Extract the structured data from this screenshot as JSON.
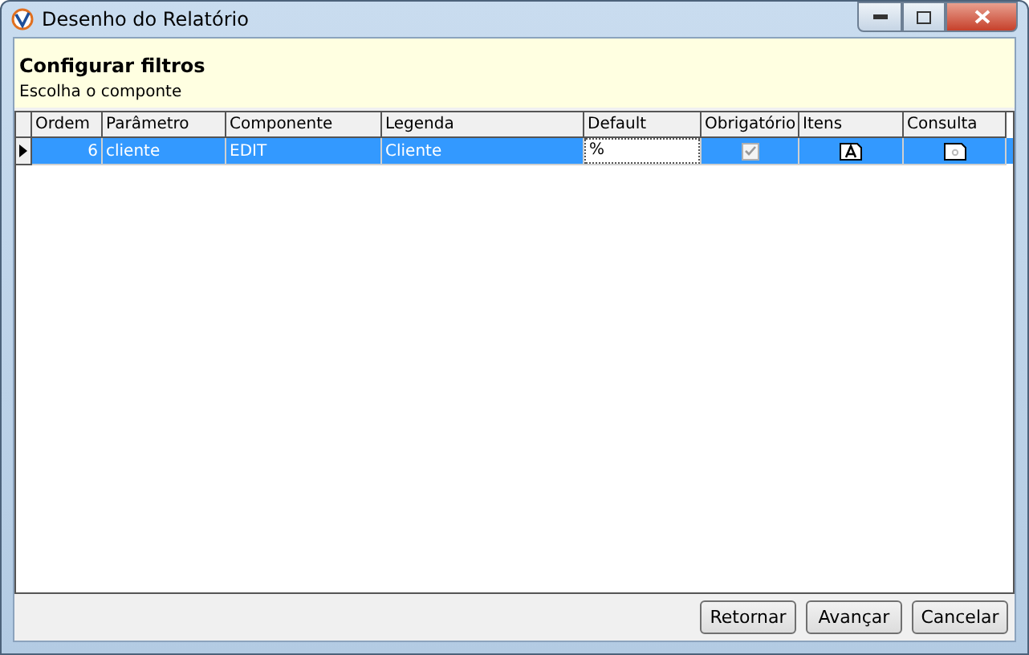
{
  "window": {
    "title": "Desenho do Relatório"
  },
  "header": {
    "title": "Configurar filtros",
    "subtitle": "Escolha o componte"
  },
  "table": {
    "columns": [
      "Ordem",
      "Parâmetro",
      "Componente",
      "Legenda",
      "Default",
      "Obrigatório",
      "Itens",
      "Consulta"
    ],
    "rows": [
      {
        "selected": true,
        "ordem": "6",
        "parametro": "cliente",
        "componente": "EDIT",
        "legenda": "Cliente",
        "default": "%",
        "obrigatorio": true
      }
    ]
  },
  "buttons": [
    "Retornar",
    "Avançar",
    "Cancelar"
  ]
}
